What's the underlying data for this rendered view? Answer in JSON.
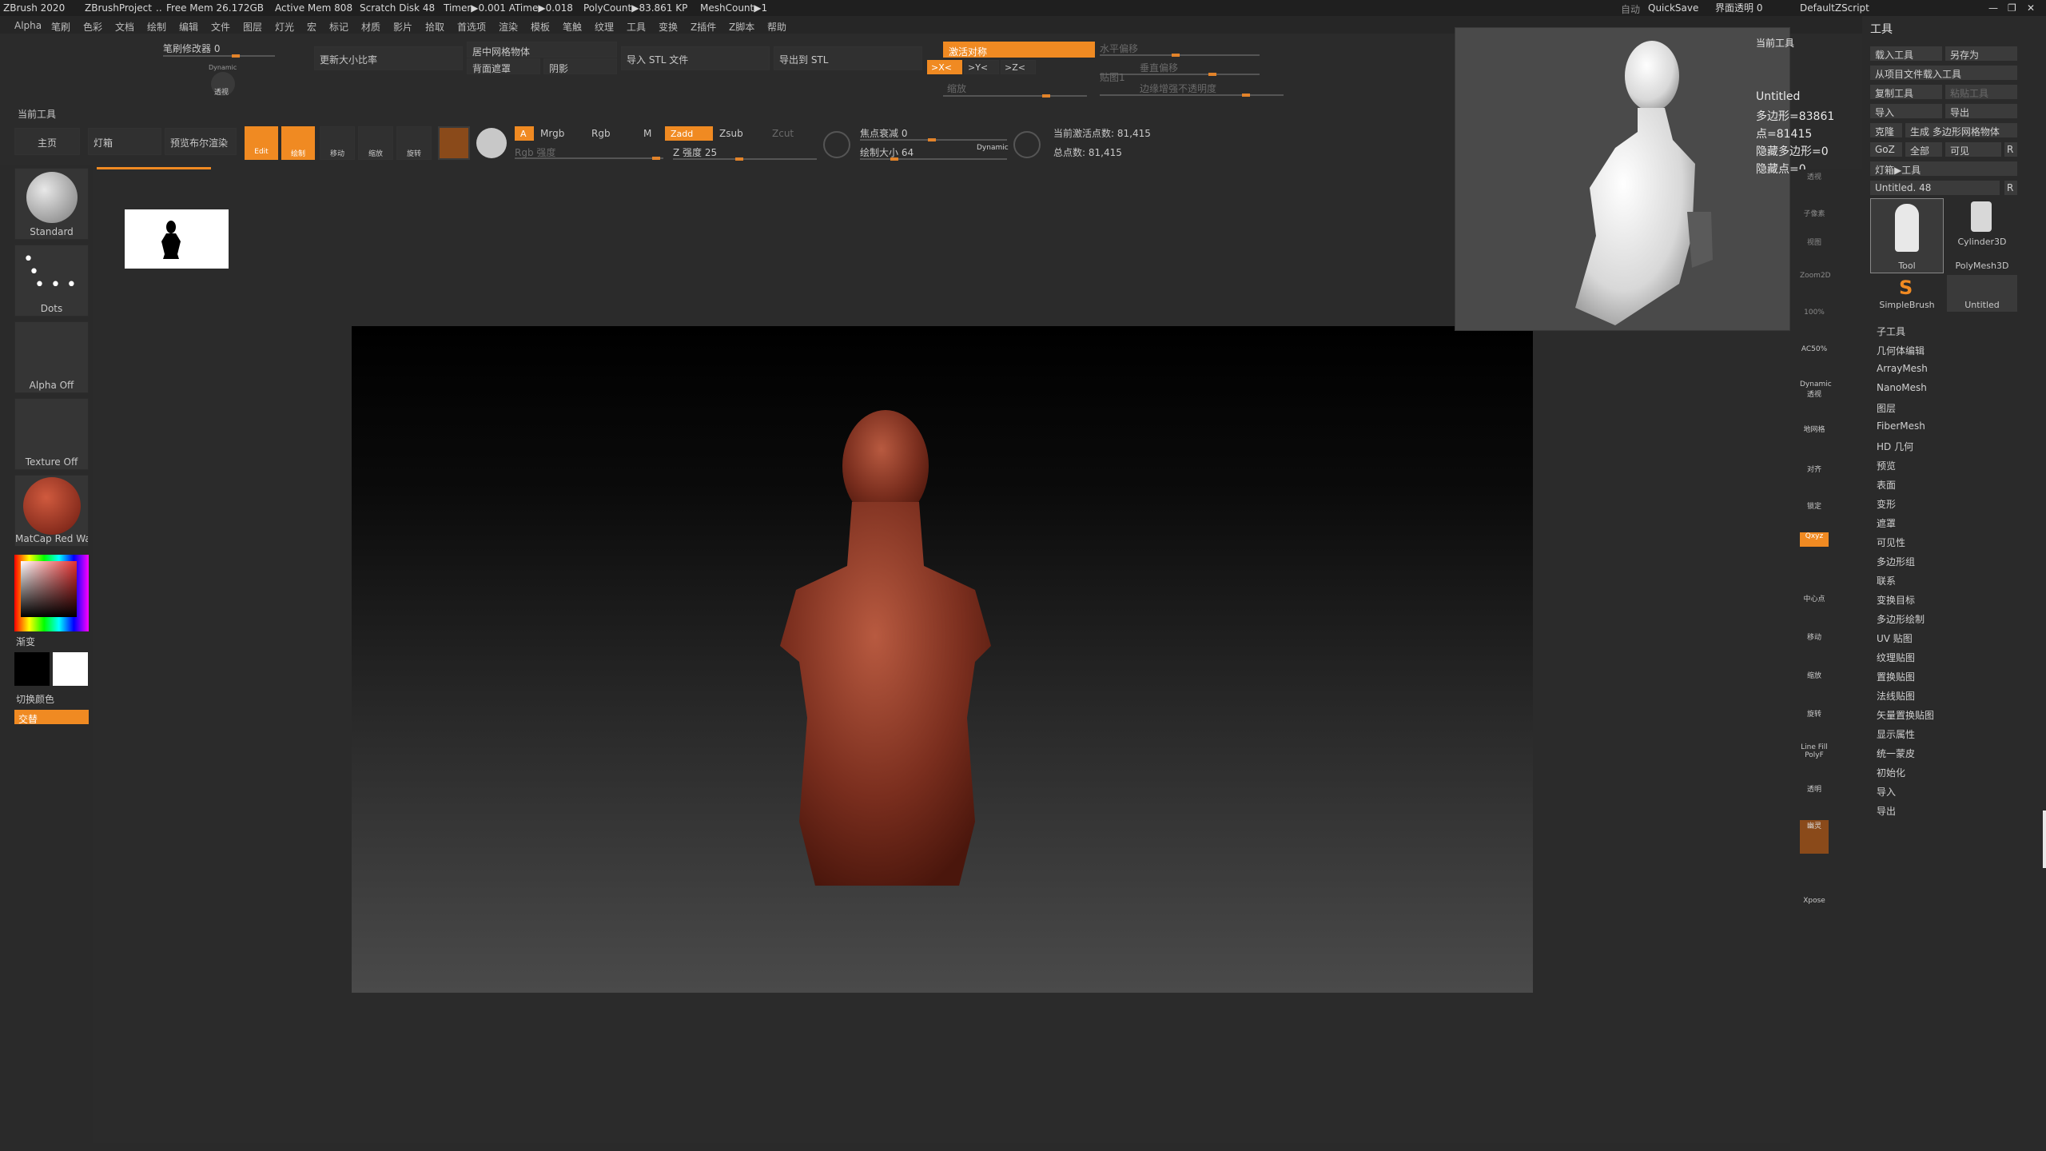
{
  "titlebar": {
    "app": "ZBrush 2020",
    "project": "ZBrushProject",
    "dots": "..",
    "free_mem": "Free Mem 26.172GB",
    "active_mem": "Active Mem 808",
    "scratch": "Scratch Disk 48",
    "timer": "Timer▶0.001 ATime▶0.018",
    "polycount": "PolyCount▶83.861 KP",
    "meshcount": "MeshCount▶1",
    "auto": "自动",
    "quicksave": "QuickSave",
    "ui_transparency": "界面透明 0",
    "script": "DefaultZScript"
  },
  "menu": [
    "Alpha",
    "笔刷",
    "色彩",
    "文档",
    "绘制",
    "编辑",
    "文件",
    "图层",
    "灯光",
    "宏",
    "标记",
    "材质",
    "影片",
    "拾取",
    "首选项",
    "渲染",
    "模板",
    "笔触",
    "纹理",
    "工具",
    "变换",
    "Z插件",
    "Z脚本",
    "帮助"
  ],
  "top": {
    "brush_mod": "笔刷修改器 0",
    "dynamic": "Dynamic",
    "dynamic_sub": "透视",
    "update_ratio": "更新大小比率",
    "center_mesh": "居中网格物体",
    "back_mask": "背面遮罩",
    "shadow": "阴影",
    "import_stl": "导入 STL 文件",
    "export_stl": "导出到 STL",
    "activate_sym": "激活对称",
    "x_btn": ">X<",
    "y_btn": ">Y<",
    "z_btn": ">Z<",
    "h_offset": "水平偏移",
    "v_offset": "垂直偏移",
    "zoom": "缩放",
    "sticker": "贴图1",
    "edge_opacity": "边缘增强不透明度"
  },
  "current_tool_label": "当前工具",
  "row2": {
    "home": "主页",
    "lightbox": "灯箱",
    "preview_bpr": "预览布尔渲染",
    "edit": "Edit",
    "draw": "绘制",
    "move": "移动",
    "scale": "缩放",
    "rotate": "旋转",
    "a": "A",
    "mrgb": "Mrgb",
    "rgb": "Rgb",
    "m": "M",
    "rgb_intensity": "Rgb 强度",
    "zadd": "Zadd",
    "zsub": "Zsub",
    "zcut": "Zcut",
    "z_intensity": "Z 强度 25",
    "focal_shift": "焦点衰减 0",
    "draw_size": "绘制大小 64",
    "dynamic": "Dynamic",
    "active_points": "当前激活点数: 81,415",
    "total_points": "总点数: 81,415"
  },
  "left": {
    "standard": "Standard",
    "dots": "Dots",
    "alpha_off": "Alpha Off",
    "texture_off": "Texture Off",
    "matcap": "MatCap Red Wa",
    "gradient": "渐变",
    "switch_color": "切换颜色",
    "alternate": "交替"
  },
  "preview": {
    "title": "当前工具",
    "name": "Untitled",
    "polys": "多边形=83861",
    "points": "点=81415",
    "hidden_polys": "隐藏多边形=0",
    "hidden_points": "隐藏点=0"
  },
  "shelf": [
    "透视",
    "子像素",
    "视图",
    "Zoom2D",
    "100%",
    "AC50%",
    "Dynamic 透视",
    "地网格",
    "对齐",
    "锁定",
    "Qxyz",
    "中心点",
    "移动",
    "缩放",
    "旋转",
    "Line Fill PolyF",
    "透明",
    "幽灵",
    "Xpose"
  ],
  "tool": {
    "title": "工具",
    "load": "载入工具",
    "save_as": "另存为",
    "load_from_project": "从项目文件载入工具",
    "copy": "复制工具",
    "paste": "粘贴工具",
    "import": "导入",
    "export": "导出",
    "clone": "克隆",
    "make_polymesh": "生成 多边形网格物体",
    "goz": "GoZ",
    "all": "全部",
    "visible": "可见",
    "r": "R",
    "lightbox_tools": "灯箱▶工具",
    "untitled_slider": "Untitled. 48",
    "thumbs": [
      "Tool",
      "Cylinder3D",
      "PolyMesh3D",
      "SimpleBrush",
      "Untitled"
    ],
    "sections": [
      "子工具",
      "几何体编辑",
      "ArrayMesh",
      "NanoMesh",
      "图层",
      "FiberMesh",
      "HD 几何",
      "预览",
      "表面",
      "变形",
      "遮罩",
      "可见性",
      "多边形组",
      "联系",
      "变换目标",
      "多边形绘制",
      "UV 贴图",
      "纹理贴图",
      "置换贴图",
      "法线贴图",
      "矢量置换贴图",
      "显示属性",
      "统一蒙皮",
      "初始化",
      "导入",
      "导出"
    ]
  },
  "colors": {
    "accent": "#f08a22",
    "bg": "#2a2a2a",
    "model": "#8a3a2a"
  }
}
